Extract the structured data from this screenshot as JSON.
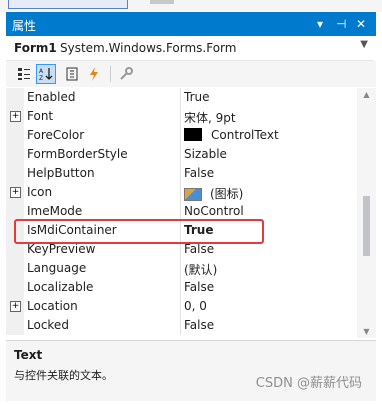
{
  "panel": {
    "title": "属性",
    "dropdown_icon": "chevron-down",
    "pin_icon": "pin",
    "close_icon": "close"
  },
  "object": {
    "name": "Form1",
    "type": "System.Windows.Forms.Form"
  },
  "toolbar": {
    "buttons": [
      "categorized-icon",
      "alphabetical-icon",
      "properties-icon",
      "events-icon",
      "property-pages-icon"
    ],
    "selected": "alphabetical-icon"
  },
  "properties": [
    {
      "name": "Enabled",
      "value": "True"
    },
    {
      "name": "Font",
      "value": "宋体, 9pt",
      "expandable": true
    },
    {
      "name": "ForeColor",
      "value": "ControlText",
      "swatch": "#000000"
    },
    {
      "name": "FormBorderStyle",
      "value": "Sizable"
    },
    {
      "name": "HelpButton",
      "value": "False"
    },
    {
      "name": "Icon",
      "value": "(图标)",
      "expandable": true
    },
    {
      "name": "ImeMode",
      "value": "NoControl"
    },
    {
      "name": "IsMdiContainer",
      "value": "True",
      "bold": true,
      "highlighted": true
    },
    {
      "name": "KeyPreview",
      "value": "False"
    },
    {
      "name": "Language",
      "value": "(默认)"
    },
    {
      "name": "Localizable",
      "value": "False"
    },
    {
      "name": "Location",
      "value": "0, 0",
      "expandable": true
    },
    {
      "name": "Locked",
      "value": "False"
    }
  ],
  "description": {
    "title": "Text",
    "text": "与控件关联的文本。"
  },
  "watermark": "CSDN @薪薪代码",
  "colors": {
    "titlebar": "#007acc",
    "highlight_border": "#e23b3b",
    "selected_button": "#c9def5"
  }
}
